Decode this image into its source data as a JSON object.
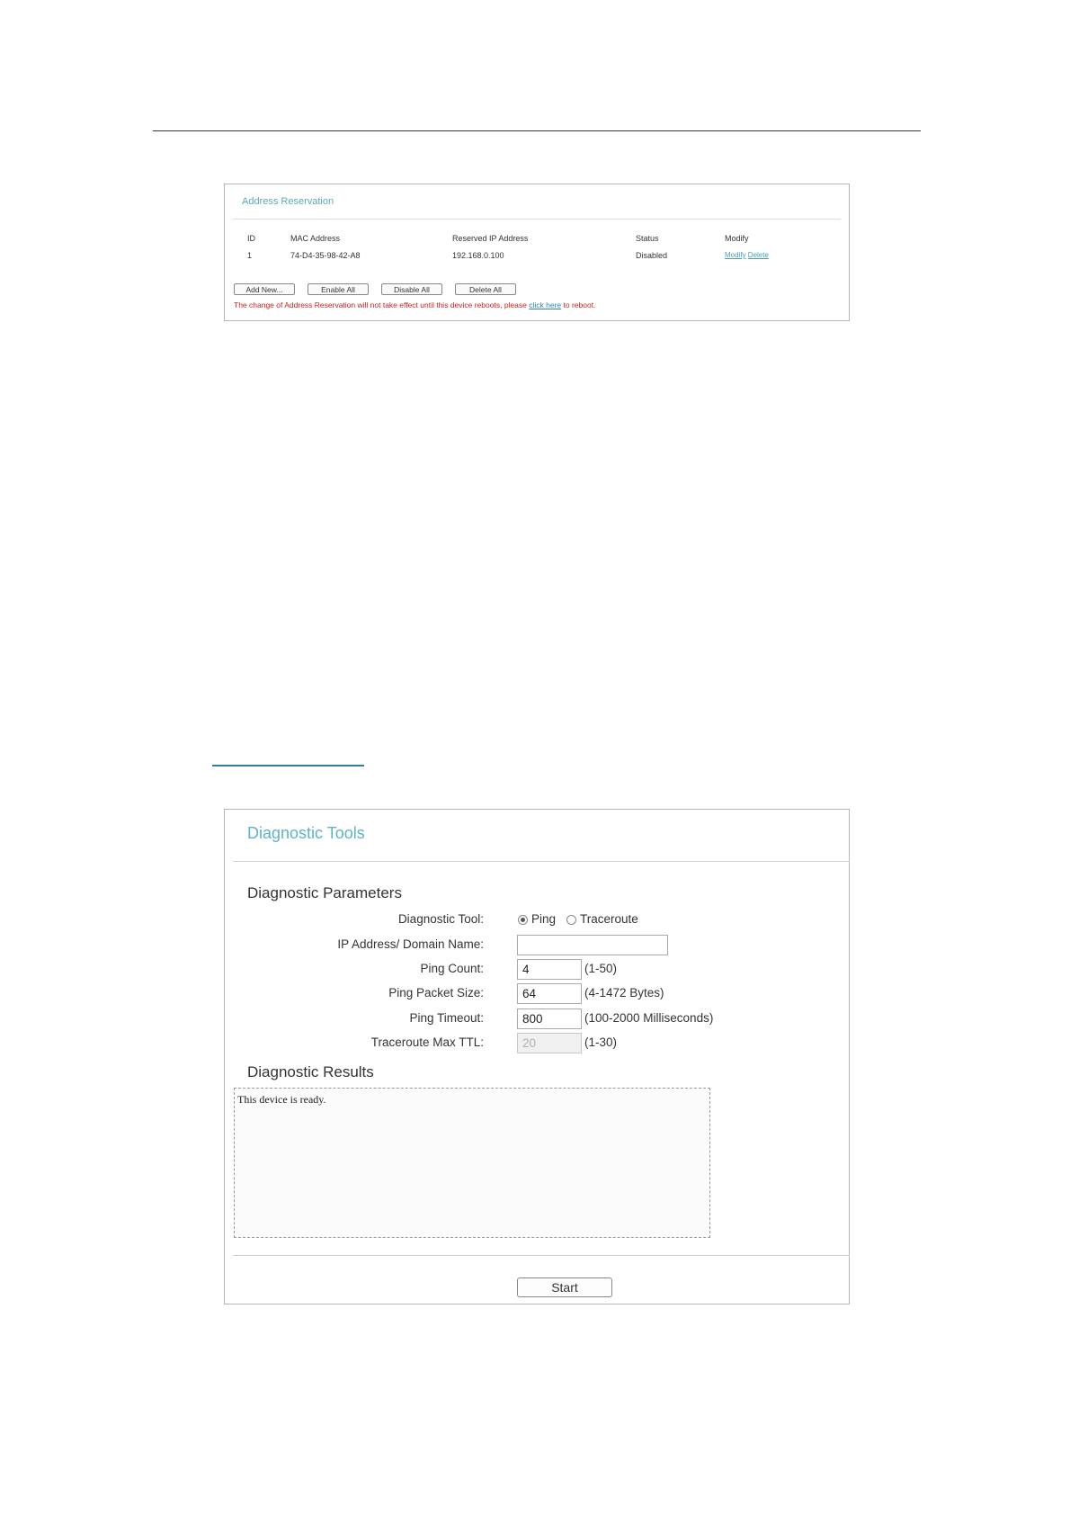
{
  "address_reservation": {
    "title": "Address Reservation",
    "columns": [
      "ID",
      "MAC Address",
      "Reserved IP Address",
      "Status",
      "Modify"
    ],
    "rows": [
      {
        "id": "1",
        "mac": "74-D4-35-98-42-A8",
        "ip": "192.168.0.100",
        "status": "Disabled",
        "modify": "Modify",
        "delete": "Delete"
      }
    ],
    "buttons": {
      "add_new": "Add New...",
      "enable_all": "Enable All",
      "disable_all": "Disable All",
      "delete_all": "Delete All"
    },
    "note": {
      "before": "The change of Address Reservation will not take effect until this device reboots, please ",
      "link": "click here",
      "after": " to reboot."
    }
  },
  "diagnostic_tools": {
    "title": "Diagnostic Tools",
    "parameters_heading": "Diagnostic Parameters",
    "results_heading": "Diagnostic Results",
    "fields": {
      "tool_label": "Diagnostic Tool:",
      "tool_options": [
        "Ping",
        "Traceroute"
      ],
      "tool_selected": "Ping",
      "ip_label": "IP Address/ Domain Name:",
      "ip_value": "",
      "ping_count_label": "Ping Count:",
      "ping_count_value": "4",
      "ping_count_hint": "(1-50)",
      "packet_size_label": "Ping Packet Size:",
      "packet_size_value": "64",
      "packet_size_hint": "(4-1472 Bytes)",
      "timeout_label": "Ping Timeout:",
      "timeout_value": "800",
      "timeout_hint": "(100-2000 Milliseconds)",
      "ttl_label": "Traceroute Max TTL:",
      "ttl_value": "20",
      "ttl_hint": "(1-30)"
    },
    "results_text": "This device is ready.",
    "start_button": "Start"
  },
  "colors": {
    "accent": "#5fb3c4",
    "warning": "#cc1f1f",
    "link": "#4a9fb5"
  }
}
